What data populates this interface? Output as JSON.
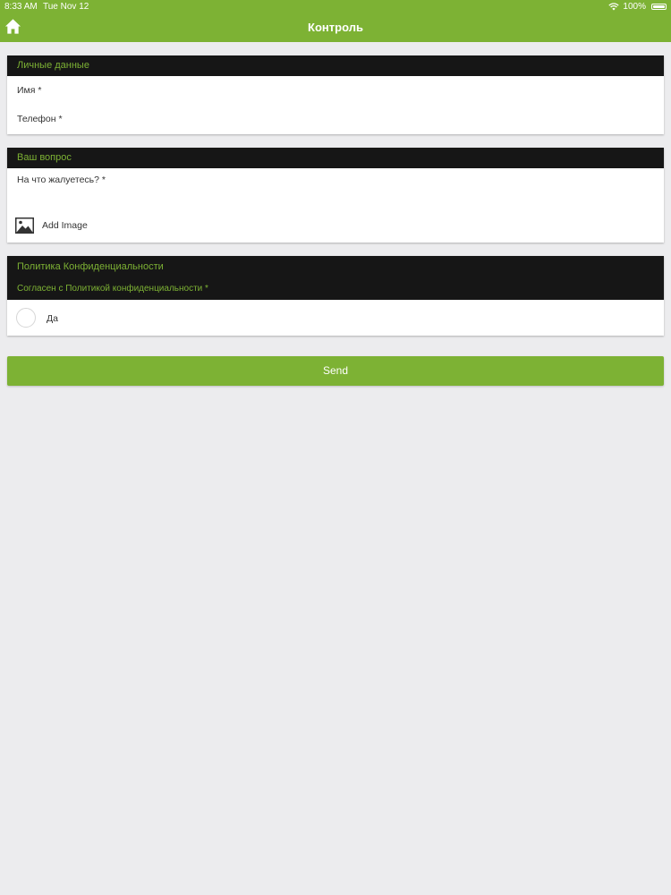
{
  "status_bar": {
    "time": "8:33 AM",
    "date": "Tue Nov 12",
    "battery": "100%"
  },
  "nav": {
    "title": "Контроль",
    "home_icon": "home-icon"
  },
  "personal": {
    "header": "Личные данные",
    "name_label": "Имя *",
    "phone_label": "Телефон *"
  },
  "question": {
    "header": "Ваш вопрос",
    "complaint_label": "На что жалуетесь? *",
    "add_image_label": "Add Image",
    "image_icon": "image-icon"
  },
  "policy": {
    "header": "Политика Конфиденциальности",
    "consent_label": "Согласен с Политикой конфиденциальности *",
    "option_label": "Да"
  },
  "actions": {
    "send_label": "Send"
  },
  "colors": {
    "accent": "#7db234",
    "header_dark": "#161616",
    "background": "#ececee"
  }
}
